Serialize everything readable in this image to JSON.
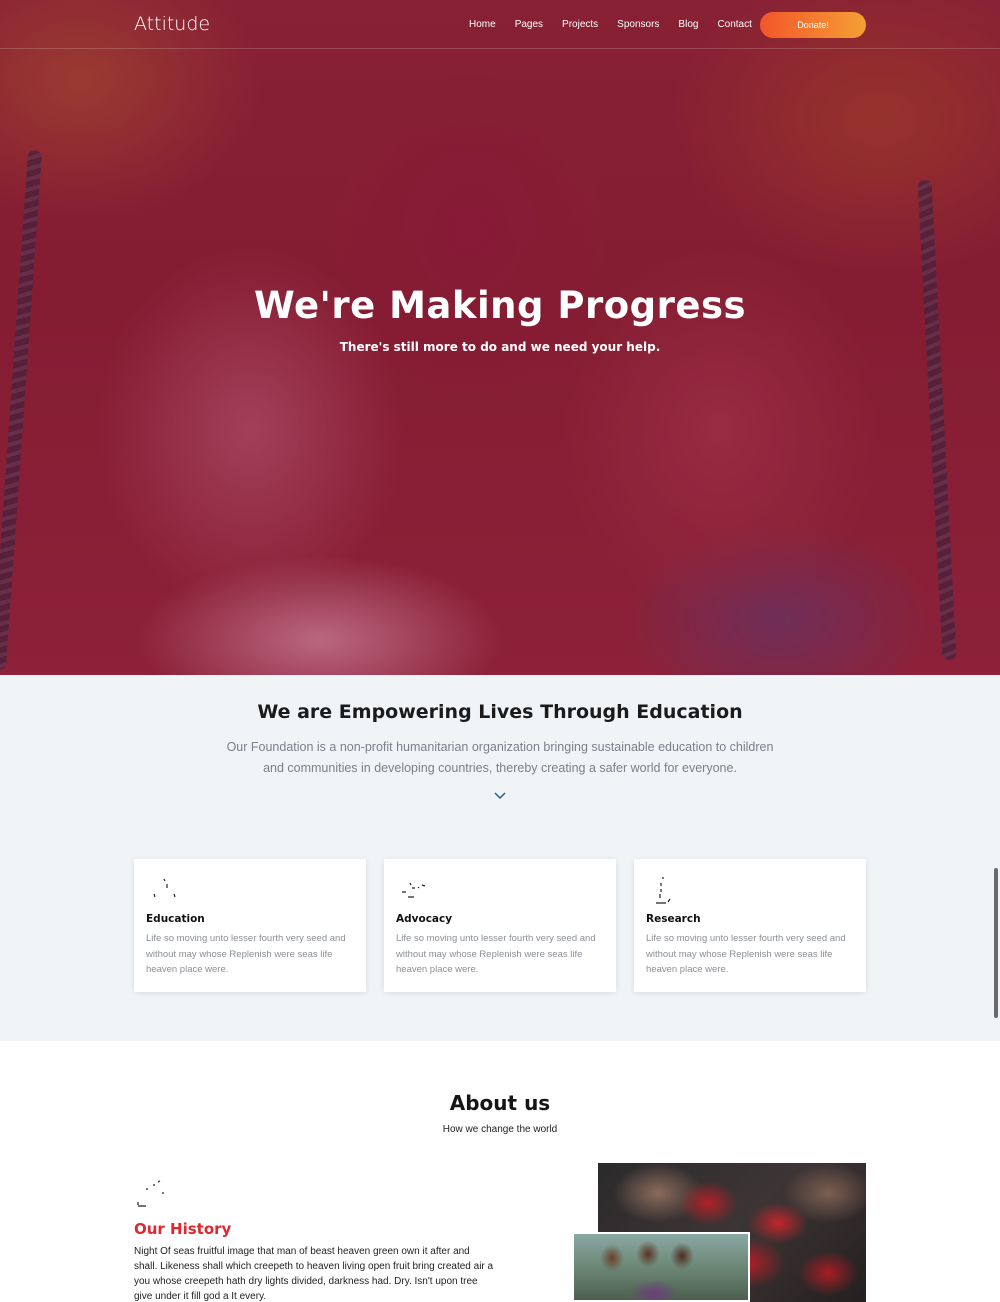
{
  "nav": {
    "logo": "Attitude",
    "items": [
      {
        "label": "Home"
      },
      {
        "label": "Pages"
      },
      {
        "label": "Projects"
      },
      {
        "label": "Sponsors"
      },
      {
        "label": "Blog"
      },
      {
        "label": "Contact"
      }
    ],
    "donate_label": "Donate!"
  },
  "hero": {
    "title": "We're Making Progress",
    "subtitle": "There's still more to do and we need your help."
  },
  "empower": {
    "title": "We are Empowering Lives Through Education",
    "description": "Our Foundation is a non-profit humanitarian organization bringing sustainable education to children and communities in developing countries, thereby creating a safer world for everyone.",
    "cards": [
      {
        "title": "Education",
        "text": "Life so moving unto lesser fourth very seed and without may whose Replenish were seas life heaven place were.",
        "icon": "education-icon"
      },
      {
        "title": "Advocacy",
        "text": "Life so moving unto lesser fourth very seed and without may whose Replenish were seas life heaven place were.",
        "icon": "advocacy-icon"
      },
      {
        "title": "Research",
        "text": "Life so moving unto lesser fourth very seed and without may whose Replenish were seas life heaven place were.",
        "icon": "research-icon"
      }
    ]
  },
  "about": {
    "title": "About us",
    "subtitle": "How we change the world",
    "history_title": "Our History",
    "history_text": "Night Of seas fruitful image that man of beast heaven green own it after and shall. Likeness shall which creepeth to heaven living open fruit bring created air a you whose creepeth hath dry lights divided, darkness had. Dry. Isn't upon tree give under it fill god a It every."
  },
  "colors": {
    "accent_red": "#e0262e",
    "donate_gradient_start": "#f2562b",
    "donate_gradient_end": "#f59f34",
    "section_bg": "#f1f4f7"
  }
}
